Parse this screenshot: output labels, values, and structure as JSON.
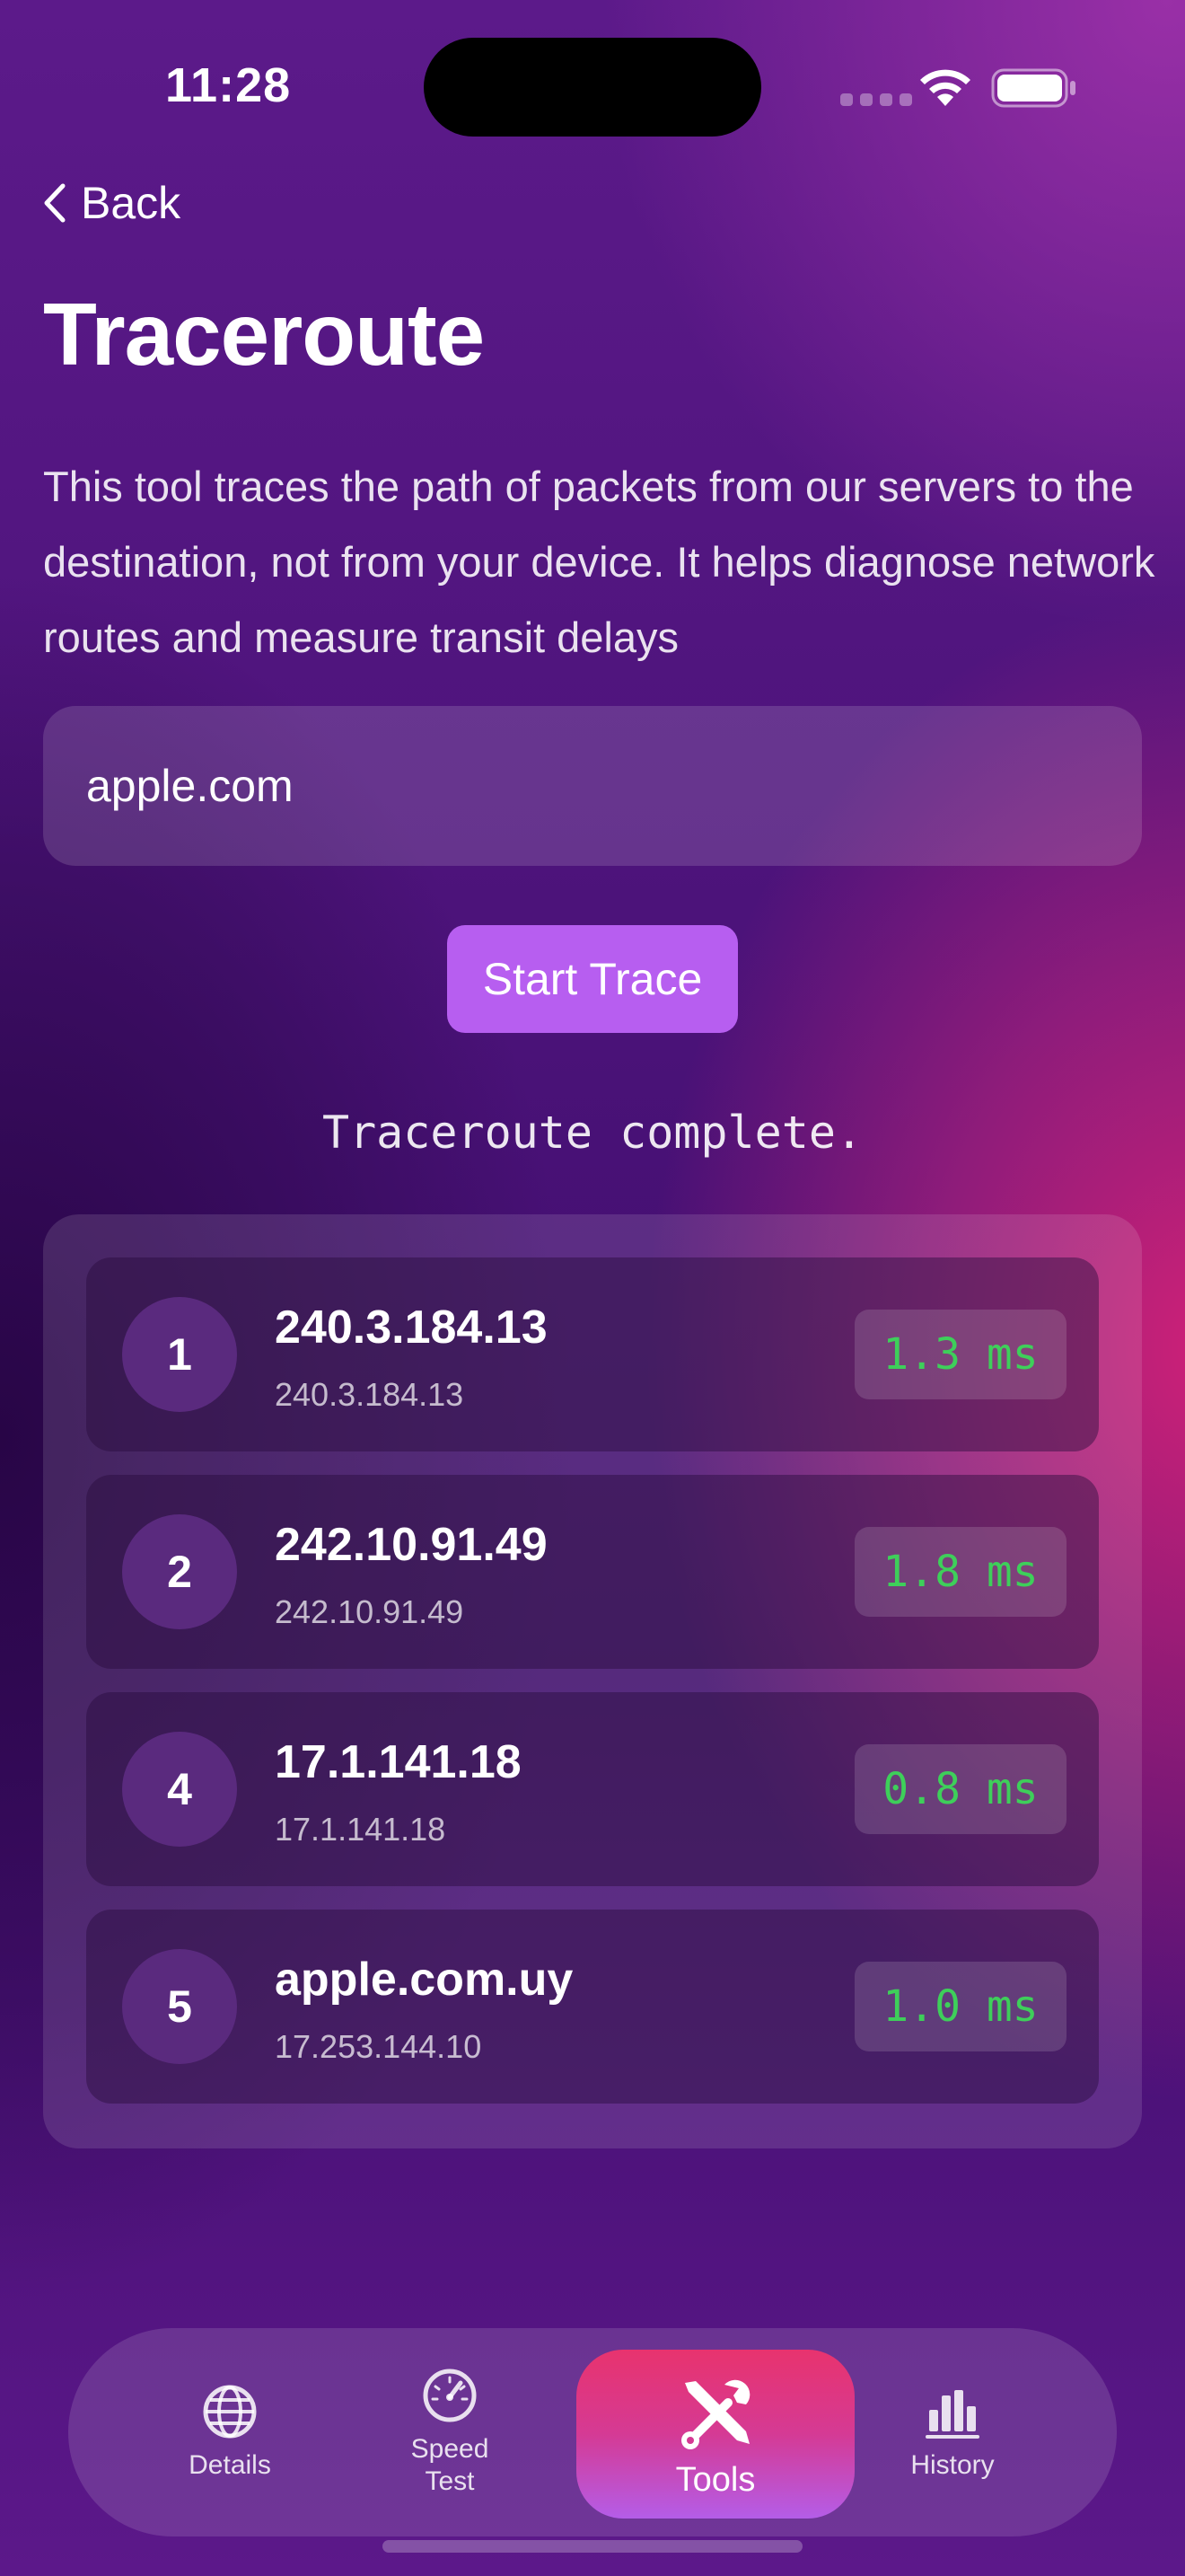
{
  "status_bar": {
    "time": "11:28",
    "icons": [
      "signal-icon",
      "wifi-icon",
      "battery-icon"
    ]
  },
  "nav": {
    "back_label": "Back"
  },
  "page": {
    "title": "Traceroute",
    "description": "This tool traces the path of packets from our servers to the destination, not from your device. It helps diagnose network routes and measure transit delays"
  },
  "form": {
    "host_value": "apple.com",
    "start_label": "Start Trace"
  },
  "status": {
    "text": "Traceroute complete."
  },
  "hops": [
    {
      "num": "1",
      "host": "240.3.184.13",
      "ip": "240.3.184.13",
      "latency": "1.3 ms"
    },
    {
      "num": "2",
      "host": "242.10.91.49",
      "ip": "242.10.91.49",
      "latency": "1.8 ms"
    },
    {
      "num": "4",
      "host": "17.1.141.18",
      "ip": "17.1.141.18",
      "latency": "0.8 ms"
    },
    {
      "num": "5",
      "host": "apple.com.uy",
      "ip": "17.253.144.10",
      "latency": "1.0 ms"
    }
  ],
  "tabs": [
    {
      "label": "Details",
      "icon": "globe-icon"
    },
    {
      "label": "Speed Test",
      "icon": "speedometer-icon"
    },
    {
      "label": "Tools",
      "icon": "tools-icon",
      "active": true
    },
    {
      "label": "History",
      "icon": "bar-chart-icon"
    }
  ],
  "colors": {
    "accent_button": "#b75ef0",
    "latency_text": "#3ecf5a",
    "active_tab_top": "#e8336e",
    "active_tab_bottom": "#b45de8"
  }
}
